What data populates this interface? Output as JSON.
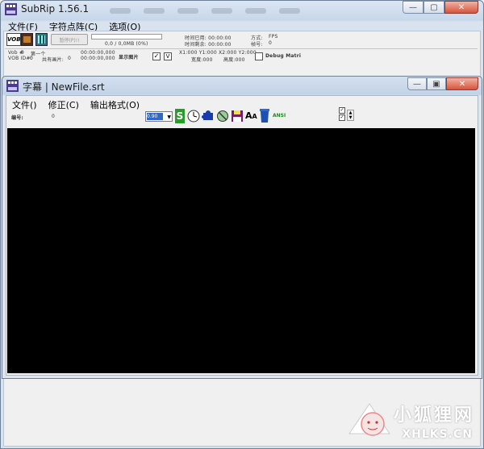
{
  "main_window": {
    "title": "SubRip 1.56.1",
    "menu": [
      "文件(F)",
      "字符点阵(C)",
      "选项(O)"
    ],
    "pause_label": "暂停(P)!!",
    "progress_text": "0,0 / 0,0MB (0%)",
    "time_used_label": "时间已用: 00:00:00",
    "time_left_label": "时间剩余: 00:00:00",
    "mode_label": "方式:",
    "mode_value": "FPS",
    "frame_label": "帧号:",
    "frame_value": "0",
    "vob_label": "Vob #",
    "vob_value": "0",
    "vob_id_label": "VOB ID#:",
    "vob_id_value": "0",
    "pages_label": "第一个",
    "total_label": "共有画片:",
    "total_value": "0",
    "time_a": "00:00:00,000",
    "time_b": "00:00:00,000",
    "show_image_label": "显示图片",
    "coords_x": "X1:000 Y1:000 X2:000 Y2:000",
    "width_label": "宽度:000",
    "height_label": "高度:000",
    "debug_label": "Debug Matri",
    "checkbox_v": "V",
    "check_mark": "✓"
  },
  "sub_window": {
    "title": "字幕 | NewFile.srt",
    "menu": [
      "文件()",
      "修正(C)",
      "输出格式(O)"
    ],
    "number_label": "编号:",
    "number_value": "0",
    "combo_value": "0.90",
    "ansi_label": "ANSI"
  },
  "watermark": {
    "cn": "小狐狸网",
    "en": "XHLKS.CN"
  },
  "colors": {
    "title_gradient_top": "#dbe6f3",
    "close_red": "#d9533a",
    "content_black": "#000000"
  }
}
